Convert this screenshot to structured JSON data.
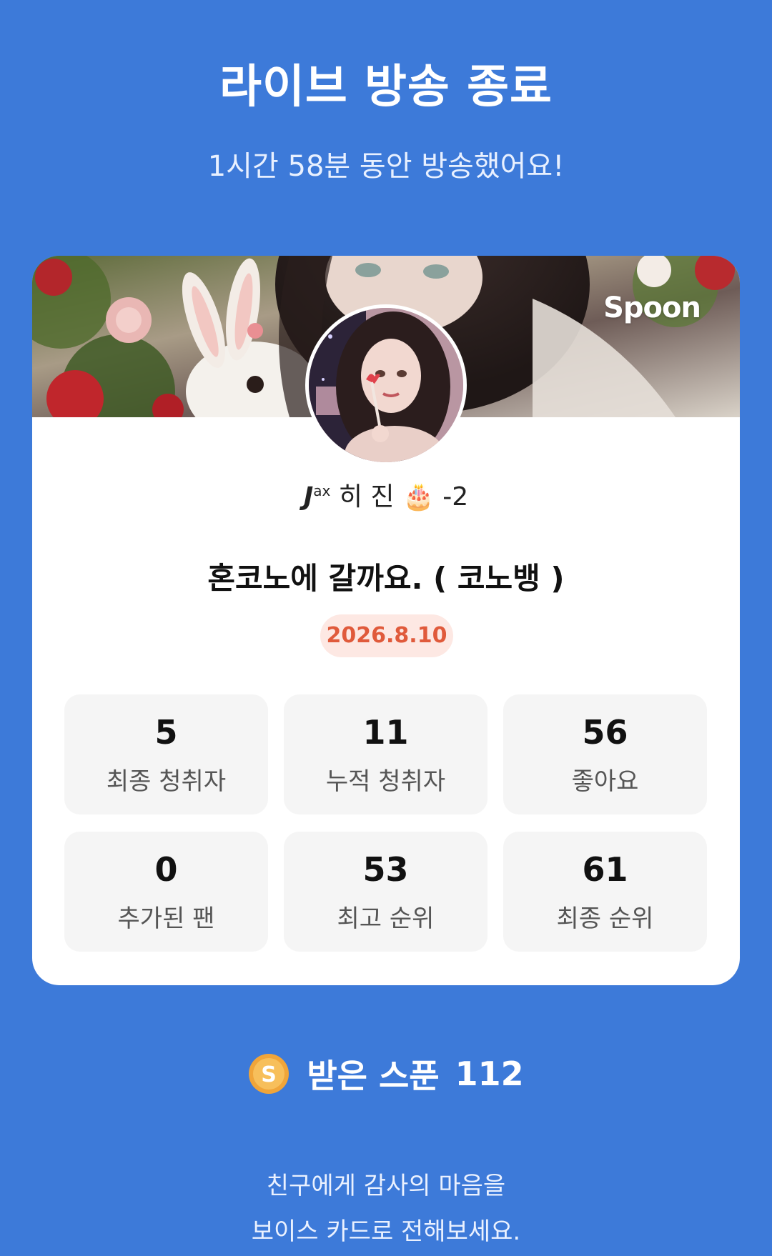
{
  "header": {
    "title": "라이브 방송 종료",
    "subtitle": "1시간 58분 동안 방송했어요!"
  },
  "card": {
    "logo": "Spoon",
    "banner_image": "anime-girl-with-white-rabbit-and-roses",
    "avatar_image": "anime-girl-holding-heart-lollipop",
    "nickname": {
      "tag_letter": "J",
      "tag_sup": "ax",
      "name": "히 진",
      "emoji": "🎂",
      "suffix": "-2"
    },
    "room_title": "혼코노에 갈까요. ( 코노뱅 )",
    "date": "2026.8.10",
    "stats": [
      {
        "value": "5",
        "label": "최종 청취자"
      },
      {
        "value": "11",
        "label": "누적 청취자"
      },
      {
        "value": "56",
        "label": "좋아요"
      },
      {
        "value": "0",
        "label": "추가된 팬"
      },
      {
        "value": "53",
        "label": "최고 순위"
      },
      {
        "value": "61",
        "label": "최종 순위"
      }
    ]
  },
  "spoons": {
    "icon": "spoon-coin-icon",
    "label": "받은 스푼",
    "count": "112"
  },
  "footer": {
    "line1": "친구에게 감사의 마음을",
    "line2": "보이스 카드로 전해보세요."
  },
  "colors": {
    "background": "#3d7ad9",
    "card": "#ffffff",
    "stat_tile": "#f5f5f5",
    "date_pill_bg": "#fde8e3",
    "date_pill_text": "#e05a3b",
    "coin": "#f0a53a"
  }
}
